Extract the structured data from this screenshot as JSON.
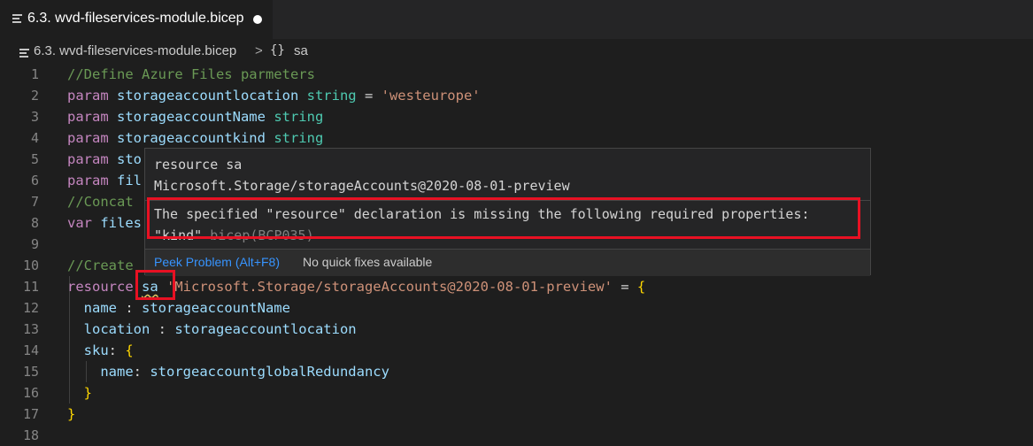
{
  "tab": {
    "title": "6.3. wvd-fileservices-module.bicep",
    "icon": "file-lines-icon",
    "dirty_indicator": "unsaved-dot-icon"
  },
  "breadcrumb": {
    "file": "6.3. wvd-fileservices-module.bicep",
    "separator": ">",
    "symbol_icon": "{}",
    "symbol": "sa"
  },
  "lines": [
    {
      "n": "1",
      "tokens": [
        {
          "t": "//Define Azure Files parmeters",
          "c": "cm"
        }
      ]
    },
    {
      "n": "2",
      "tokens": [
        {
          "t": "param ",
          "c": "kw"
        },
        {
          "t": "storageaccountlocation ",
          "c": "id"
        },
        {
          "t": "string",
          "c": "ty"
        },
        {
          "t": " = ",
          "c": "pl"
        },
        {
          "t": "'westeurope'",
          "c": "str"
        }
      ]
    },
    {
      "n": "3",
      "tokens": [
        {
          "t": "param ",
          "c": "kw"
        },
        {
          "t": "storageaccountName ",
          "c": "id"
        },
        {
          "t": "string",
          "c": "ty"
        }
      ]
    },
    {
      "n": "4",
      "tokens": [
        {
          "t": "param ",
          "c": "kw"
        },
        {
          "t": "storageaccountkind ",
          "c": "id"
        },
        {
          "t": "string",
          "c": "ty"
        }
      ]
    },
    {
      "n": "5",
      "tokens": [
        {
          "t": "param ",
          "c": "kw"
        },
        {
          "t": "sto",
          "c": "id"
        }
      ]
    },
    {
      "n": "6",
      "tokens": [
        {
          "t": "param ",
          "c": "kw"
        },
        {
          "t": "fil",
          "c": "id"
        }
      ]
    },
    {
      "n": "7",
      "tokens": [
        {
          "t": "//Concat",
          "c": "cm"
        }
      ]
    },
    {
      "n": "8",
      "tokens": [
        {
          "t": "var ",
          "c": "kw"
        },
        {
          "t": "files",
          "c": "id"
        }
      ]
    },
    {
      "n": "9",
      "tokens": []
    },
    {
      "n": "10",
      "tokens": [
        {
          "t": "//Create",
          "c": "cm"
        }
      ]
    },
    {
      "n": "11",
      "tokens": [
        {
          "t": "resource ",
          "c": "kw"
        },
        {
          "t": "sa",
          "c": "id squig"
        },
        {
          "t": " 'Microsoft.Storage/storageAccounts@2020-08-01-preview'",
          "c": "str"
        },
        {
          "t": " = ",
          "c": "pl"
        },
        {
          "t": "{",
          "c": "br"
        }
      ]
    },
    {
      "n": "12",
      "tokens": [
        {
          "t": "  name",
          "c": "id"
        },
        {
          "t": " : ",
          "c": "pl"
        },
        {
          "t": "storageaccountName",
          "c": "id"
        }
      ]
    },
    {
      "n": "13",
      "tokens": [
        {
          "t": "  location",
          "c": "id"
        },
        {
          "t": " : ",
          "c": "pl"
        },
        {
          "t": "storageaccountlocation",
          "c": "id"
        }
      ]
    },
    {
      "n": "14",
      "tokens": [
        {
          "t": "  sku",
          "c": "id"
        },
        {
          "t": ": ",
          "c": "pl"
        },
        {
          "t": "{",
          "c": "br"
        }
      ]
    },
    {
      "n": "15",
      "tokens": [
        {
          "t": "    name",
          "c": "id"
        },
        {
          "t": ": ",
          "c": "pl"
        },
        {
          "t": "storgeaccountglobalRedundancy",
          "c": "id"
        }
      ]
    },
    {
      "n": "16",
      "tokens": [
        {
          "t": "  }",
          "c": "br"
        }
      ]
    },
    {
      "n": "17",
      "tokens": [
        {
          "t": "}",
          "c": "br"
        }
      ]
    },
    {
      "n": "18",
      "tokens": []
    }
  ],
  "hover": {
    "signature_line1": "resource sa",
    "signature_line2": "Microsoft.Storage/storageAccounts@2020-08-01-preview",
    "message_line1": "The specified \"resource\" declaration is missing the following required properties:",
    "message_line2_kind": "\"kind\"",
    "message_line2_code": "bicep(BCP035)",
    "peek_problem": "Peek Problem (Alt+F8)",
    "no_quick_fixes": "No quick fixes available"
  },
  "colors": {
    "background": "#1e1e1e",
    "keyword": "#c586c0",
    "identifier": "#9cdcfe",
    "type": "#4ec9b0",
    "string": "#ce9178",
    "comment": "#6a9955",
    "highlight_box": "#e81123",
    "link": "#3794ff"
  }
}
